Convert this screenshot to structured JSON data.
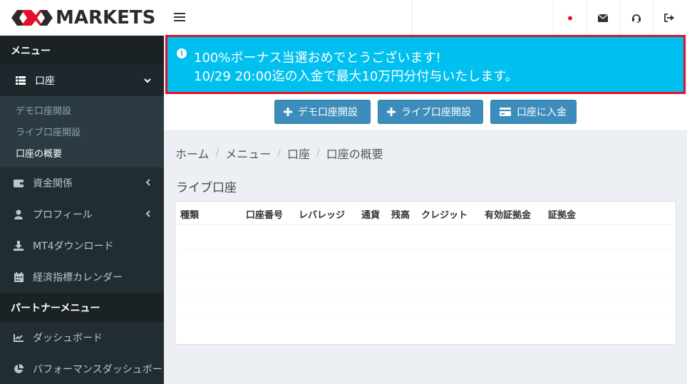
{
  "brand": {
    "logo_text": "MARKETS"
  },
  "sidebar": {
    "menu_header": "メニュー",
    "account": {
      "label": "口座",
      "sub_items": [
        {
          "label": "デモ口座開設"
        },
        {
          "label": "ライブ口座開設"
        },
        {
          "label": "口座の概要"
        }
      ]
    },
    "items": [
      {
        "label": "資金関係"
      },
      {
        "label": "プロフィール"
      },
      {
        "label": "MT4ダウンロード"
      },
      {
        "label": "経済指標カレンダー"
      }
    ],
    "partner_header": "パートナーメニュー",
    "partner_items": [
      {
        "label": "ダッシュボード"
      },
      {
        "label": "パフォーマンスダッシュボー"
      }
    ]
  },
  "alert": {
    "line1": "100%ボーナス当選おめでとうございます!",
    "line2": "10/29 20:00迄の入金で最大10万円分付与いたします。"
  },
  "actions": {
    "demo_label": "デモ口座開設",
    "live_label": "ライブ口座開設",
    "deposit_label": "口座に入金"
  },
  "breadcrumb": [
    "ホーム",
    "メニュー",
    "口座",
    "口座の概要"
  ],
  "section_title": "ライブ口座",
  "table": {
    "headers": [
      "種類",
      "口座番号",
      "レバレッジ",
      "通貨",
      "残高",
      "クレジット",
      "有効証拠金",
      "証拠金"
    ]
  },
  "colors": {
    "sidebar_bg": "#222d32",
    "alert_bg": "#00c0ef",
    "alert_border": "#e3102a",
    "button_bg": "#3c8dbc"
  }
}
